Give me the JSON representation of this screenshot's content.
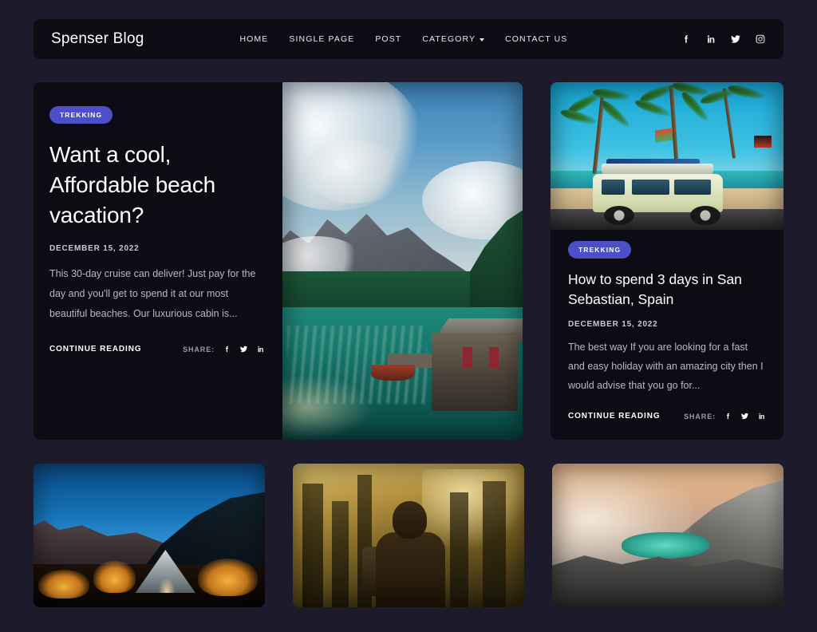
{
  "theme": {
    "page_bg": "#1c1a2b",
    "card_bg": "#0d0c15",
    "badge_bg": "#4c4fc9",
    "text_primary": "#ffffff",
    "text_muted": "#b9b9c6"
  },
  "header": {
    "brand": "Spenser Blog",
    "nav": [
      {
        "label": "HOME",
        "has_caret": false
      },
      {
        "label": "SINGLE PAGE",
        "has_caret": false
      },
      {
        "label": "POST",
        "has_caret": false
      },
      {
        "label": "CATEGORY",
        "has_caret": true
      },
      {
        "label": "CONTACT US",
        "has_caret": false
      }
    ],
    "social": [
      {
        "name": "facebook-icon"
      },
      {
        "name": "linkedin-icon"
      },
      {
        "name": "twitter-icon"
      },
      {
        "name": "instagram-icon"
      }
    ]
  },
  "featured_post": {
    "category": "TREKKING",
    "title": "Want a cool, Affordable beach vacation?",
    "date": "DECEMBER 15, 2022",
    "excerpt": "This 30-day cruise can deliver! Just pay for the day and you'll get to spend it at our most beautiful beaches. Our luxurious cabin is...",
    "continue_label": "CONTINUE READING",
    "share_label": "SHARE:",
    "image_alt": "mountain-lake-cabin-photo"
  },
  "side_post": {
    "category": "TREKKING",
    "title": "How to spend 3 days in San Sebastian, Spain",
    "date": "DECEMBER 15, 2022",
    "excerpt": "The best way If you are looking for a fast and easy holiday with an amazing city then I would advise that you go for...",
    "continue_label": "CONTINUE READING",
    "share_label": "SHARE:",
    "image_alt": "vintage-campervan-beach-photo"
  },
  "bottom_posts": [
    {
      "image_alt": "night-camping-tent-photo"
    },
    {
      "image_alt": "forest-hiker-backpack-photo"
    },
    {
      "image_alt": "volcano-crater-lake-photo"
    }
  ],
  "share_icons": [
    {
      "name": "facebook-icon"
    },
    {
      "name": "twitter-icon"
    },
    {
      "name": "linkedin-icon"
    }
  ]
}
